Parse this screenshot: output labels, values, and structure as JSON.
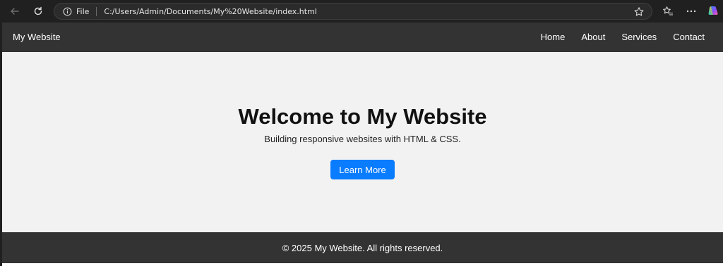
{
  "browser": {
    "scheme_label": "File",
    "url": "C:/Users/Admin/Documents/My%20Website/index.html",
    "icons": [
      "back-icon",
      "refresh-icon",
      "info-icon",
      "star-icon",
      "favorites-icon",
      "more-icon",
      "copilot-icon"
    ]
  },
  "site": {
    "logo": "My Website",
    "nav": [
      "Home",
      "About",
      "Services",
      "Contact"
    ],
    "hero": {
      "title": "Welcome to My Website",
      "subtitle": "Building responsive websites with HTML & CSS.",
      "button": "Learn More"
    },
    "footer": "© 2025 My Website. All rights reserved."
  },
  "colors": {
    "chrome": "#202020",
    "header": "#333333",
    "hero_bg": "#f2f2f2",
    "button": "#0a7cff"
  }
}
